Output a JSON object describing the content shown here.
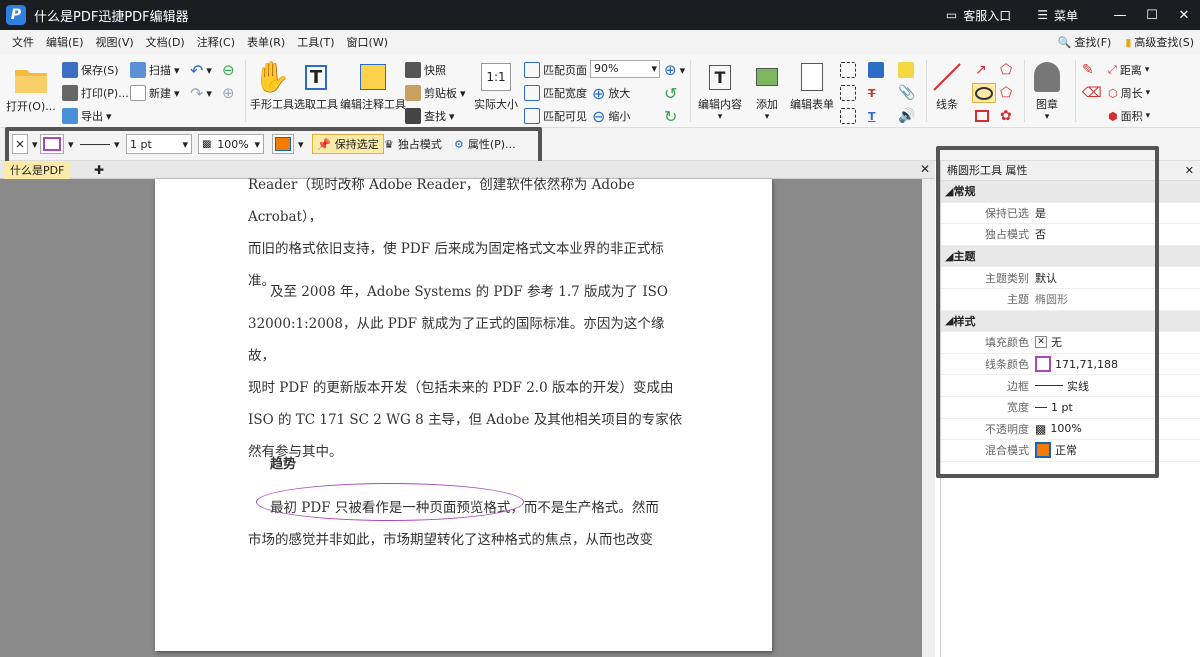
{
  "window": {
    "title": "什么是PDF迅捷PDF编辑器",
    "support": "客服入口",
    "menu": "菜单"
  },
  "menu": [
    "文件",
    "编辑(E)",
    "视图(V)",
    "文档(D)",
    "注释(C)",
    "表单(R)",
    "工具(T)",
    "窗口(W)"
  ],
  "find": {
    "find": "查找(F)",
    "advanced": "高级查找(S)"
  },
  "ribbon": {
    "open": "打开(O)...",
    "save": "保存(S)",
    "print": "打印(P)...",
    "export": "导出",
    "scan": "扫描",
    "new": "新建",
    "hand": "手形工具",
    "select": "选取工具",
    "edit_annot": "编辑注释工具",
    "snapshot": "快照",
    "clipboard": "剪贴板",
    "search": "查找",
    "actual": "实际大小",
    "fit_page": "匹配页面",
    "fit_width": "匹配宽度",
    "fit_visible": "匹配可见",
    "zoom": "90%",
    "zoom_in": "放大",
    "zoom_out": "缩小",
    "edit_content": "编辑内容",
    "add": "添加",
    "edit_form": "编辑表单",
    "line": "线条",
    "stamp": "图章",
    "distance": "距离",
    "perimeter": "周长",
    "area": "面积"
  },
  "subtool": {
    "width": "1 pt",
    "opacity": "100%",
    "keep": "保持选定",
    "exclusive": "独占模式",
    "props": "属性(P)..."
  },
  "tab": {
    "name": "什么是PDF"
  },
  "doc": {
    "p0a": "Reader（现时改称 Adobe Reader，创建软件依然称为 Adobe Acrobat），",
    "p0b": "而旧的格式依旧支持，使 PDF 后来成为固定格式文本业界的非正式标",
    "p0c": "准。",
    "p1a": "及至 2008 年，Adobe Systems 的 PDF 参考 1.7 版成为了 ISO",
    "p1b": "32000:1:2008，从此 PDF 就成为了正式的国际标准。亦因为这个缘故，",
    "p1c": "现时 PDF 的更新版本开发（包括未来的 PDF 2.0 版本的开发）变成由",
    "p1d": "ISO 的 TC 171 SC 2 WG 8 主导，但 Adobe 及其他相关项目的专家依",
    "p1e": "然有参与其中。",
    "h": "趋势",
    "p2a": "最初 PDF 只被看作是一种页面预览格式，而不是生产格式。然而",
    "p2b": "市场的感觉并非如此，市场期望转化了这种格式的焦点，从而也改变"
  },
  "panel": {
    "title": "椭圆形工具 属性",
    "cat1": "常规",
    "k1": "保持已选",
    "v1": "是",
    "k2": "独占模式",
    "v2": "否",
    "cat2": "主题",
    "k3": "主题类别",
    "v3": "默认",
    "k4": "主题",
    "v4": "椭圆形",
    "cat3": "样式",
    "k5": "填充颜色",
    "v5": "无",
    "k6": "线条颜色",
    "v6": "171,71,188",
    "k7": "边框",
    "v7": "实线",
    "k8": "宽度",
    "v8": "1 pt",
    "k9": "不透明度",
    "v9": "100%",
    "k10": "混合模式",
    "v10": "正常"
  },
  "colors": {
    "accent": "#ab47bc",
    "fill": "#f57c00"
  }
}
